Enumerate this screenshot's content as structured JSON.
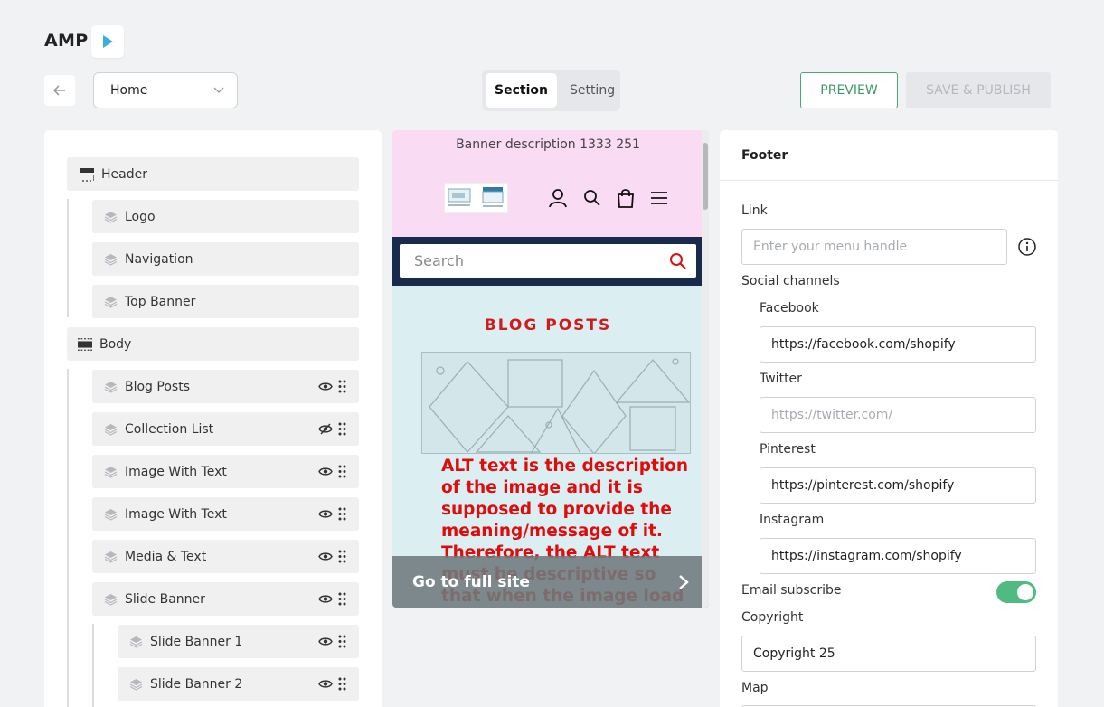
{
  "app": {
    "brand": "AMP"
  },
  "toolbar": {
    "page_select": "Home",
    "tabs": [
      {
        "label": "Section",
        "active": true
      },
      {
        "label": "Setting",
        "active": false
      }
    ],
    "preview_label": "PREVIEW",
    "publish_label": "SAVE & PUBLISH"
  },
  "sections": {
    "header": {
      "label": "Header",
      "children": [
        "Logo",
        "Navigation",
        "Top Banner"
      ]
    },
    "body": {
      "label": "Body",
      "children": [
        {
          "label": "Blog Posts",
          "visible": true
        },
        {
          "label": "Collection List",
          "visible": false
        },
        {
          "label": "Image With Text",
          "visible": true
        },
        {
          "label": "Image With Text",
          "visible": true
        },
        {
          "label": "Media & Text",
          "visible": true
        },
        {
          "label": "Slide Banner",
          "visible": true
        }
      ],
      "slide_banners": [
        {
          "label": "Slide Banner 1",
          "visible": true
        },
        {
          "label": "Slide Banner 2",
          "visible": true
        }
      ]
    }
  },
  "preview": {
    "banner_text": "Banner description 1333 251",
    "search_placeholder": "Search",
    "blog_title": "BLOG POSTS",
    "alt_text": "ALT text is the description of the image and it is supposed to provide the meaning/message of it. Therefore, the ALT text must be descriptive so that when the image load fails, the",
    "footer_link": "Go to full site"
  },
  "footer_settings": {
    "title": "Footer",
    "link_label": "Link",
    "link_placeholder": "Enter your menu handle",
    "social_label": "Social channels",
    "facebook_label": "Facebook",
    "facebook_value": "https://facebook.com/shopify",
    "twitter_label": "Twitter",
    "twitter_placeholder": "https://twitter.com/",
    "pinterest_label": "Pinterest",
    "pinterest_value": "https://pinterest.com/shopify",
    "instagram_label": "Instagram",
    "instagram_value": "https://instagram.com/shopify",
    "email_subscribe_label": "Email subscribe",
    "email_subscribe_on": true,
    "copyright_label": "Copyright",
    "copyright_value": "Copyright 25",
    "map_label": "Map"
  },
  "colors": {
    "accent_green": "#4fbb83",
    "preview_header_bg": "#fadbf4",
    "preview_search_bg": "#1a2a4c",
    "preview_body_bg": "#dbeff2",
    "alt_text_red": "#e00c0c"
  }
}
